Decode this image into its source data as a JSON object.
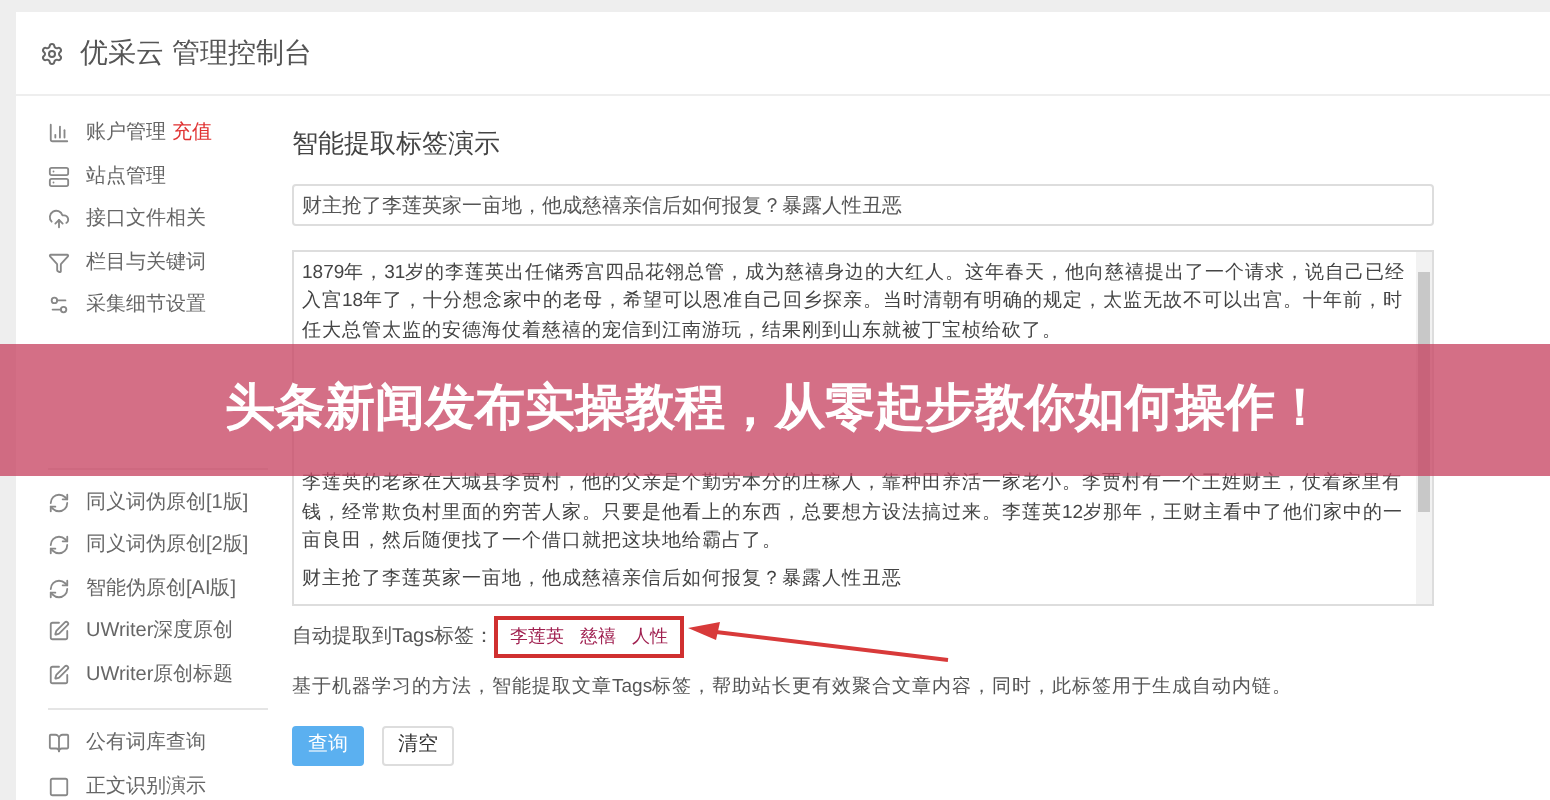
{
  "header": {
    "title": "优采云 管理控制台"
  },
  "sidebar": {
    "groups": [
      {
        "items": [
          {
            "label": "账户管理",
            "badge": "充值"
          },
          {
            "label": "站点管理"
          },
          {
            "label": "接口文件相关"
          },
          {
            "label": "栏目与关键词"
          },
          {
            "label": "采集细节设置"
          }
        ]
      },
      {
        "items": [
          {
            "label": "同义词伪原创[1版]"
          },
          {
            "label": "同义词伪原创[2版]"
          },
          {
            "label": "智能伪原创[AI版]"
          },
          {
            "label": "UWriter深度原创"
          },
          {
            "label": "UWriter原创标题"
          }
        ]
      },
      {
        "items": [
          {
            "label": "公有词库查询"
          },
          {
            "label": "正文识别演示"
          }
        ]
      }
    ]
  },
  "main": {
    "heading": "智能提取标签演示",
    "title_field": {
      "value": "财主抢了李莲英家一亩地，他成慈禧亲信后如何报复？暴露人性丑恶"
    },
    "content_field": {
      "paragraphs": [
        "1879年，31岁的李莲英出任储秀宫四品花翎总管，成为慈禧身边的大红人。这年春天，他向慈禧提出了一个请求，说自己已经入宫18年了，十分想念家中的老母，希望可以恩准自己回乡探亲。当时清朝有明确的规定，太监无故不可以出宫。十年前，时任大总管太监的安德海仗着慈禧的宠信到江南游玩，结果刚到山东就被丁宝桢给砍了。",
        "李莲英的老家在大城县李贾村，他的父亲是个勤劳本分的庄稼人，靠种田养活一家老小。李贾村有一个王姓财主，仗着家里有钱，经常欺负村里面的穷苦人家。只要是他看上的东西，总要想方设法搞过来。李莲英12岁那年，王财主看中了他们家中的一亩良田，然后随便找了一个借口就把这块地给霸占了。",
        "财主抢了李莲英家一亩地，他成慈禧亲信后如何报复？暴露人性丑恶"
      ]
    },
    "tags_label": "自动提取到Tags标签：",
    "tags": [
      "李莲英",
      "慈禧",
      "人性"
    ],
    "description": "基于机器学习的方法，智能提取文章Tags标签，帮助站长更有效聚合文章内容，同时，此标签用于生成自动内链。",
    "buttons": [
      {
        "label": "查询",
        "kind": "primary"
      },
      {
        "label": "清空",
        "kind": "default"
      }
    ]
  },
  "banner": {
    "text": "头条新闻发布实操教程，从零起步教你如何操作！"
  }
}
